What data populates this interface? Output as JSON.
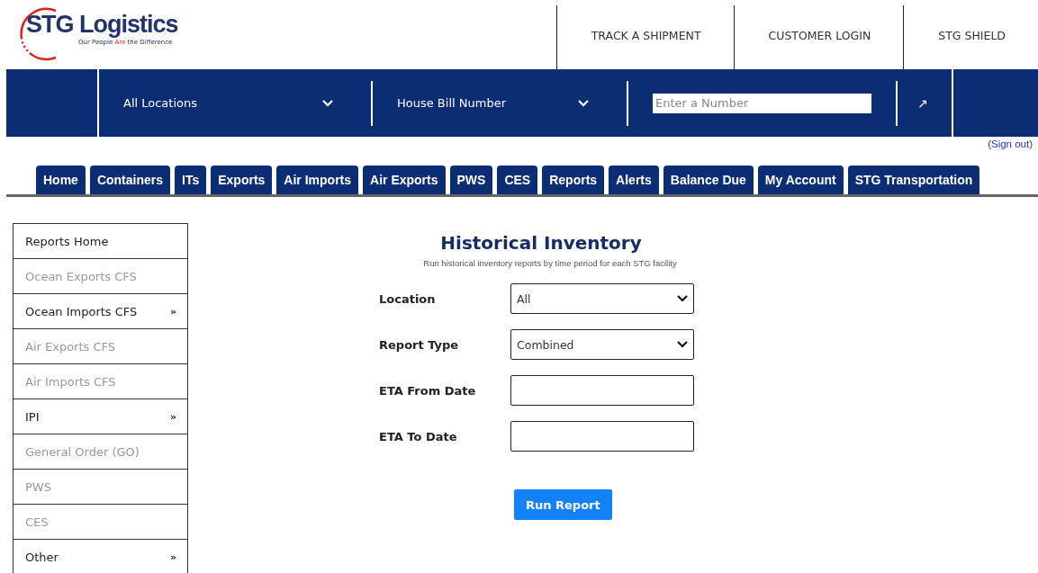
{
  "logo": {
    "name": "STG Logistics",
    "tagline": [
      {
        "text": "Our People ",
        "highlight": false
      },
      {
        "text": "Are",
        "highlight": true
      },
      {
        "text": " the Difference",
        "highlight": false
      }
    ]
  },
  "top_links": [
    "TRACK A SHIPMENT",
    "CUSTOMER LOGIN",
    "STG SHIELD"
  ],
  "search_bar": {
    "location": "All Locations",
    "number_type": "House Bill Number",
    "placeholder": "Enter a Number",
    "go": "↗"
  },
  "sign_out": "(Sign out)",
  "tabs": [
    {
      "label": "Home",
      "selected": false
    },
    {
      "label": "Containers",
      "selected": false
    },
    {
      "label": "ITs",
      "selected": false
    },
    {
      "label": "Exports",
      "selected": false
    },
    {
      "label": "Air Imports",
      "selected": false
    },
    {
      "label": "Air Exports",
      "selected": false
    },
    {
      "label": "PWS",
      "selected": false
    },
    {
      "label": "CES",
      "selected": false
    },
    {
      "label": "Reports",
      "selected": false
    },
    {
      "label": "Alerts",
      "selected": false
    },
    {
      "label": "Balance Due",
      "selected": false
    },
    {
      "label": "My Account",
      "selected": false
    },
    {
      "label": "STG Transportation",
      "selected": false
    }
  ],
  "sidebar": {
    "items": [
      {
        "label": "Reports Home",
        "disabled": false
      },
      {
        "label": "Ocean Exports CFS",
        "disabled": true
      },
      {
        "label": "Ocean Imports CFS",
        "disabled": false,
        "submenu": "»"
      },
      {
        "label": "Air Exports CFS",
        "disabled": true
      },
      {
        "label": "Air Imports CFS",
        "disabled": true
      },
      {
        "label": "IPI",
        "disabled": false,
        "submenu": "»"
      },
      {
        "label": "General Order (GO)",
        "disabled": true
      },
      {
        "label": "PWS",
        "disabled": true
      },
      {
        "label": "CES",
        "disabled": true
      },
      {
        "label": "Other",
        "disabled": false,
        "submenu": "»"
      }
    ]
  },
  "form": {
    "title": "Historical Inventory",
    "subtitle": "Run historical inventory reports by time period for each STG facility",
    "fields": [
      {
        "label": "Location",
        "kind": "select",
        "value": "All"
      },
      {
        "label": "Report Type",
        "kind": "select",
        "value": "Combined"
      },
      {
        "label": "ETA From Date",
        "kind": "text"
      },
      {
        "label": "ETA To Date",
        "kind": "text"
      }
    ],
    "button": "Run Report"
  }
}
